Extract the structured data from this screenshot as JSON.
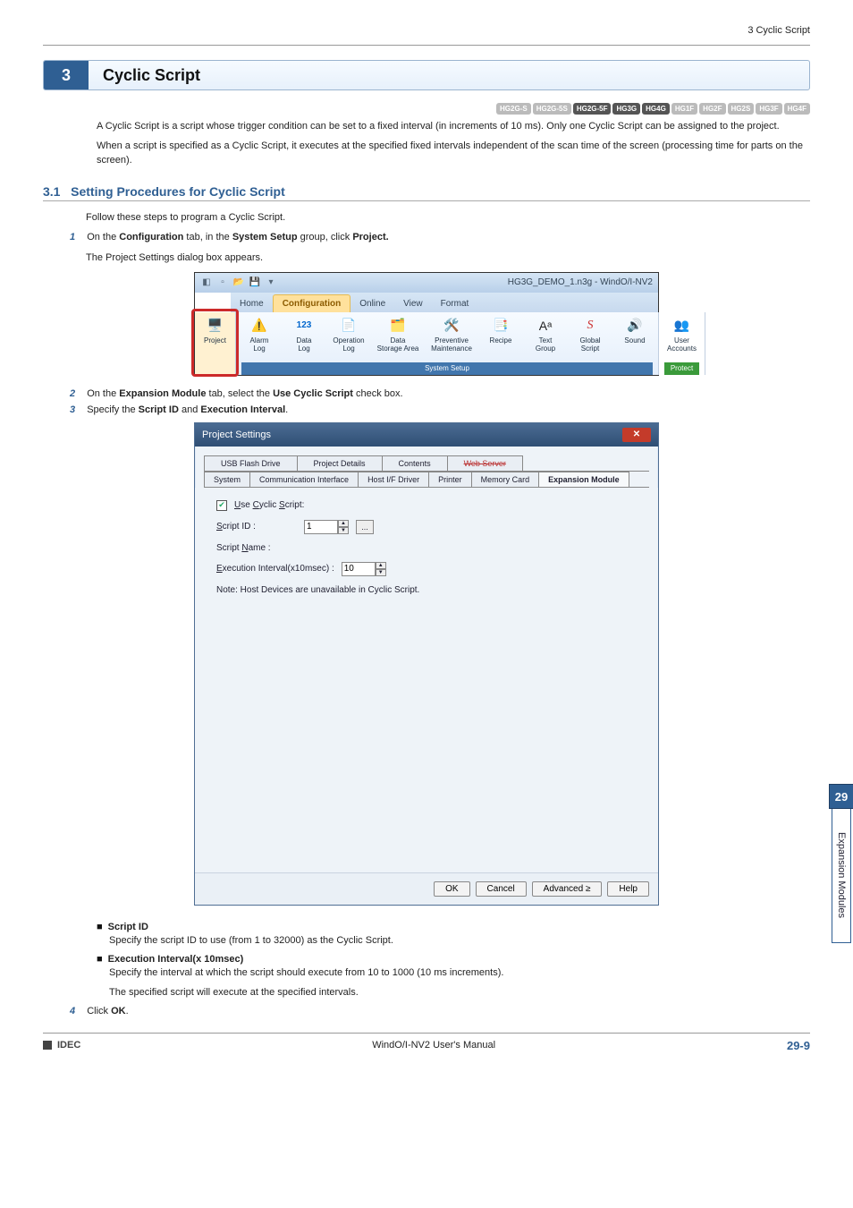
{
  "header": {
    "breadcrumb": "3 Cyclic Script"
  },
  "chapter": {
    "number": "3",
    "title": "Cyclic Script"
  },
  "badges": [
    "HG2G-S",
    "HG2G-5S",
    "HG2G-5F",
    "HG3G",
    "HG4G",
    "HG1F",
    "HG2F",
    "HG2S",
    "HG3F",
    "HG4F"
  ],
  "badge_dark_indices": [
    2,
    3,
    4
  ],
  "intro": {
    "p1": "A Cyclic Script is a script whose trigger condition can be set to a fixed interval (in increments of 10 ms). Only one Cyclic Script can be assigned to the project.",
    "p2": "When a script is specified as a Cyclic Script, it executes at the specified fixed intervals independent of the scan time of the screen (processing time for parts on the screen)."
  },
  "section": {
    "num": "3.1",
    "title": "Setting Procedures for Cyclic Script"
  },
  "section_intro": "Follow these steps to program a Cyclic Script.",
  "steps": {
    "s1_a": "On the ",
    "s1_b": "Configuration",
    "s1_c": " tab, in the ",
    "s1_d": "System Setup",
    "s1_e": " group, click ",
    "s1_f": "Project.",
    "s1_note": "The Project Settings dialog box appears.",
    "s2_a": "On the ",
    "s2_b": "Expansion Module",
    "s2_c": " tab, select the ",
    "s2_d": "Use Cyclic Script",
    "s2_e": " check box.",
    "s3_a": "Specify the ",
    "s3_b": "Script ID",
    "s3_c": " and ",
    "s3_d": "Execution Interval",
    "s3_e": ".",
    "s4": "Click ",
    "s4_b": "OK",
    "s4_c": "."
  },
  "ribbon": {
    "app_title": "HG3G_DEMO_1.n3g - WindO/I-NV2",
    "tabs": {
      "home": "Home",
      "config": "Configuration",
      "online": "Online",
      "view": "View",
      "format": "Format"
    },
    "groups": {
      "project_label": "Project",
      "alarm": "Alarm\nLog",
      "data": "Data\nLog",
      "op": "Operation\nLog",
      "data_storage": "Data\nStorage Area",
      "preventive": "Preventive\nMaintenance",
      "recipe": "Recipe",
      "text": "Text\nGroup",
      "global": "Global\nScript",
      "sound": "Sound",
      "user": "User\nAccounts",
      "setup_footer": "System Setup",
      "protect_footer": "Protect",
      "num123": "123"
    }
  },
  "dialog": {
    "title": "Project Settings",
    "tabs_row1": [
      "USB Flash Drive",
      "Project Details",
      "Contents",
      "Web Server"
    ],
    "tabs_row2": [
      "System",
      "Communication Interface",
      "Host I/F Driver",
      "Printer",
      "Memory Card",
      "Expansion Module"
    ],
    "strike_tab": "Web Server",
    "active_tab": "Expansion Module",
    "use_cyclic": "Use Cyclic Script:",
    "script_id": "Script ID :",
    "script_id_value": "1",
    "script_name": "Script Name :",
    "exec_interval": "Execution Interval(x10msec) :",
    "exec_interval_value": "10",
    "note": "Note: Host Devices are unavailable in Cyclic Script.",
    "buttons": {
      "ok": "OK",
      "cancel": "Cancel",
      "advanced": "Advanced ≥",
      "help": "Help"
    }
  },
  "bullets": {
    "script_head": "Script ID",
    "script_body": "Specify the script ID to use (from 1 to 32000) as the Cyclic Script.",
    "exec_head": "Execution Interval(x 10msec)",
    "exec_body1": "Specify the interval at which the script should execute from 10 to 1000 (10 ms increments).",
    "exec_body2": "The specified script will execute at the specified intervals."
  },
  "side": {
    "num": "29",
    "label": "Expansion Modules"
  },
  "footer": {
    "brand": "IDEC",
    "center": "WindO/I-NV2 User's Manual",
    "page": "29-9"
  }
}
